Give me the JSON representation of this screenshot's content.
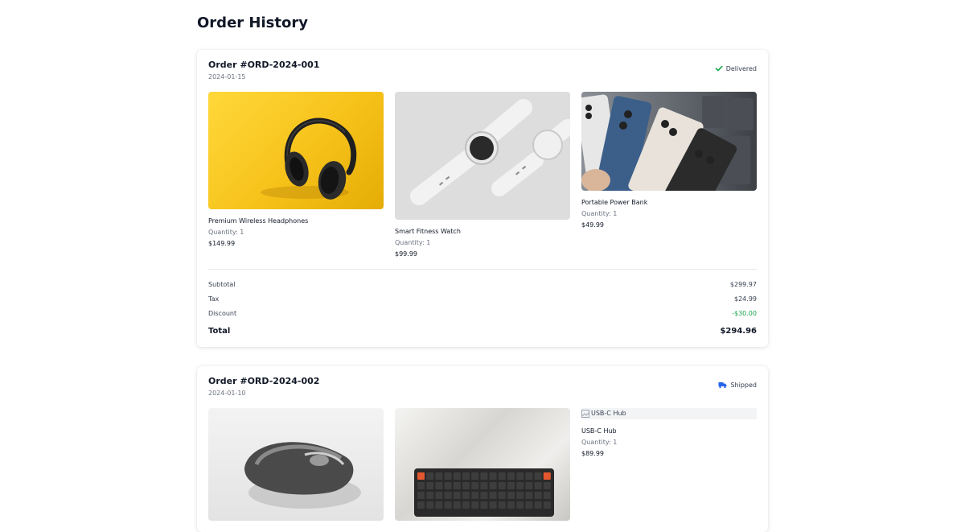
{
  "page": {
    "title": "Order History"
  },
  "orders": [
    {
      "id": "Order #ORD-2024-001",
      "date": "2024-01-15",
      "status": "Delivered",
      "status_icon": "check-icon",
      "status_color": "#16a34a",
      "items": [
        {
          "name": "Premium Wireless Headphones",
          "qty": "Quantity: 1",
          "price": "$149.99",
          "image": "headphones-photo",
          "bg": "#f5c518"
        },
        {
          "name": "Smart Fitness Watch",
          "qty": "Quantity: 1",
          "price": "$99.99",
          "image": "smartwatch-photo",
          "bg": "#dcdcdc"
        },
        {
          "name": "Portable Power Bank",
          "qty": "Quantity: 1",
          "price": "$49.99",
          "image": "phones-photo",
          "bg": "#6b7280"
        }
      ],
      "summary": {
        "subtotal_label": "Subtotal",
        "subtotal": "$299.97",
        "tax_label": "Tax",
        "tax": "$24.99",
        "discount_label": "Discount",
        "discount": "-$30.00",
        "total_label": "Total",
        "total": "$294.96"
      }
    },
    {
      "id": "Order #ORD-2024-002",
      "date": "2024-01-10",
      "status": "Shipped",
      "status_icon": "truck-icon",
      "status_color": "#2563eb",
      "items": [
        {
          "name": "",
          "image": "mouse-photo"
        },
        {
          "name": "",
          "image": "keyboard-photo"
        },
        {
          "name": "USB-C Hub",
          "alt": "USB-C Hub",
          "qty": "Quantity: 1",
          "price": "$89.99",
          "image": "broken-image-icon"
        }
      ]
    }
  ]
}
